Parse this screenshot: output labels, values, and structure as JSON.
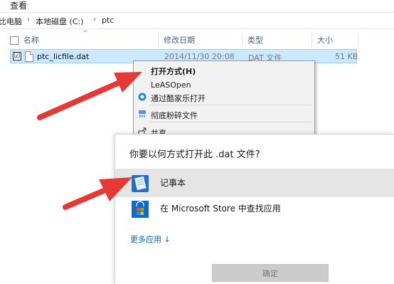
{
  "ribbon": {
    "tab_view": "查看"
  },
  "address": {
    "crumbs": [
      "比电脑",
      "本地磁盘 (C:)",
      "ptc"
    ]
  },
  "columns": {
    "name": "名称",
    "modified": "修改日期",
    "type": "类型",
    "size": "大小"
  },
  "file": {
    "name": "ptc_licfile.dat",
    "modified": "2014/11/30 20:08",
    "type": "DAT 文件",
    "size": "51 KB",
    "checked": "☑"
  },
  "context_menu": {
    "open_with": "打开方式(H)",
    "leasopen": "LeASOpen",
    "kugou_open": "通过酷家乐打开",
    "shred": "彻底粉碎文件",
    "share": "共享"
  },
  "dialog": {
    "title": "你要以何方式打开此 .dat 文件?",
    "apps": [
      {
        "name": "记事本",
        "icon": "notepad-icon"
      },
      {
        "name": "在 Microsoft Store 中查找应用",
        "icon": "microsoft-store-icon"
      }
    ],
    "more_apps": "更多应用 ↓",
    "ok": "确定"
  },
  "colors": {
    "accent": "#0067c0",
    "selection": "#cce8ff",
    "arrow": "#e53935"
  }
}
